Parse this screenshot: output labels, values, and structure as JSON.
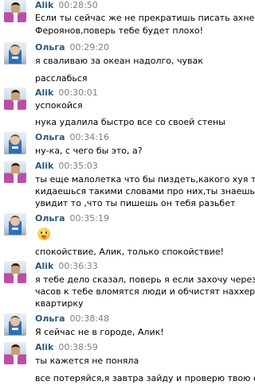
{
  "messages": [
    {
      "author": "Alik",
      "time": "00:28:50",
      "lines": [
        "Если ты сейчас же не прекратишь писать ахнею про",
        "Фероянов,поверь тебе будет плохо!"
      ]
    },
    {
      "author": "Ольга",
      "time": "00:29:20",
      "lines": [
        "я сваливаю за океан надолго, чувак",
        "расслабься"
      ]
    },
    {
      "author": "Alik",
      "time": "00:30:01",
      "lines": [
        "успокойся",
        "нука удалила быстро все со своей стены"
      ]
    },
    {
      "author": "Ольга",
      "time": "00:34:16",
      "lines": [
        "ну-ка, с чего бы это, а?"
      ]
    },
    {
      "author": "Alik",
      "time": "00:35:03",
      "lines": [
        "ты еще малолетка что бы пиздеть,какого хуя ты тут",
        "кидаешься такими словами про них,ты знаешь если он",
        "увидит то ,что ты пишешь он тебя разьбет"
      ]
    },
    {
      "author": "Ольга",
      "time": "00:35:19",
      "emoji": "tongue-out-smiley",
      "lines": [
        "спокойствие, Алик, только спокойствие!"
      ]
    },
    {
      "author": "Alik",
      "time": "00:36:33",
      "lines": [
        "я тебе дело сказал, поверь я если захочу через пару",
        "часов к тебе вломятся люди и обчистят наххер твою",
        "квартирку"
      ]
    },
    {
      "author": "Ольга",
      "time": "00:38:48",
      "lines": [
        "Я сейчас не в городе, Алик!"
      ]
    },
    {
      "author": "Alik",
      "time": "00:38:59",
      "lines": [
        "ты кажется не поняла",
        "все потеряйся,я завтра зайду и проверю твою стену"
      ]
    }
  ]
}
